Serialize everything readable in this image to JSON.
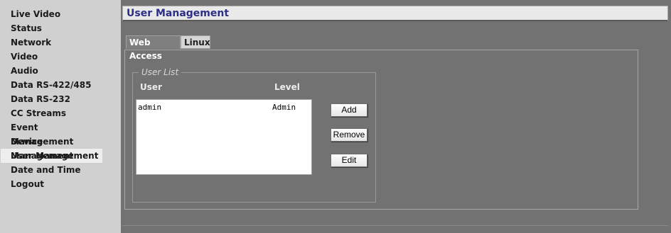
{
  "sidebar": {
    "items": [
      {
        "label": "Live Video"
      },
      {
        "label": "Status"
      },
      {
        "label": "Network"
      },
      {
        "label": "Video"
      },
      {
        "label": "Audio"
      },
      {
        "label": "Data RS-422/485"
      },
      {
        "label": "Data RS-232"
      },
      {
        "label": "CC Streams"
      },
      {
        "label": "Event Management"
      },
      {
        "label": "Device Management"
      },
      {
        "label": "User Management"
      },
      {
        "label": "Date and Time"
      },
      {
        "label": "Logout"
      }
    ],
    "active_index": 10
  },
  "header": {
    "title": "User Management"
  },
  "tabs": [
    {
      "label": "Web Access",
      "selected": true
    },
    {
      "label": "Linux",
      "selected": false
    }
  ],
  "user_list": {
    "legend": "User List",
    "columns": {
      "user": "User",
      "level": "Level"
    },
    "rows": [
      {
        "user": "admin",
        "level": "Admin"
      }
    ]
  },
  "buttons": {
    "add": "Add",
    "remove": "Remove",
    "edit": "Edit"
  },
  "colors": {
    "background": "#727272",
    "sidebar": "#d0d0d0",
    "title": "#2b2f86"
  }
}
